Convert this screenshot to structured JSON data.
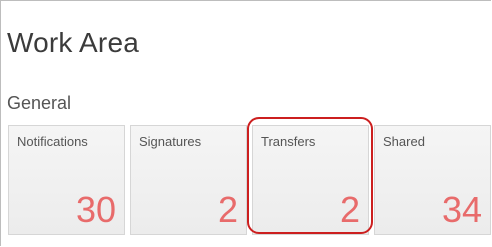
{
  "header": {
    "title": "Work Area"
  },
  "section": {
    "title": "General"
  },
  "tiles": [
    {
      "label": "Notifications",
      "count": "30"
    },
    {
      "label": "Signatures",
      "count": "2"
    },
    {
      "label": "Transfers",
      "count": "2"
    },
    {
      "label": "Shared",
      "count": "34"
    }
  ],
  "colors": {
    "count_text": "#e86b6b",
    "highlight_border": "#cc1f1f",
    "tile_background": "#f2f2f2"
  }
}
